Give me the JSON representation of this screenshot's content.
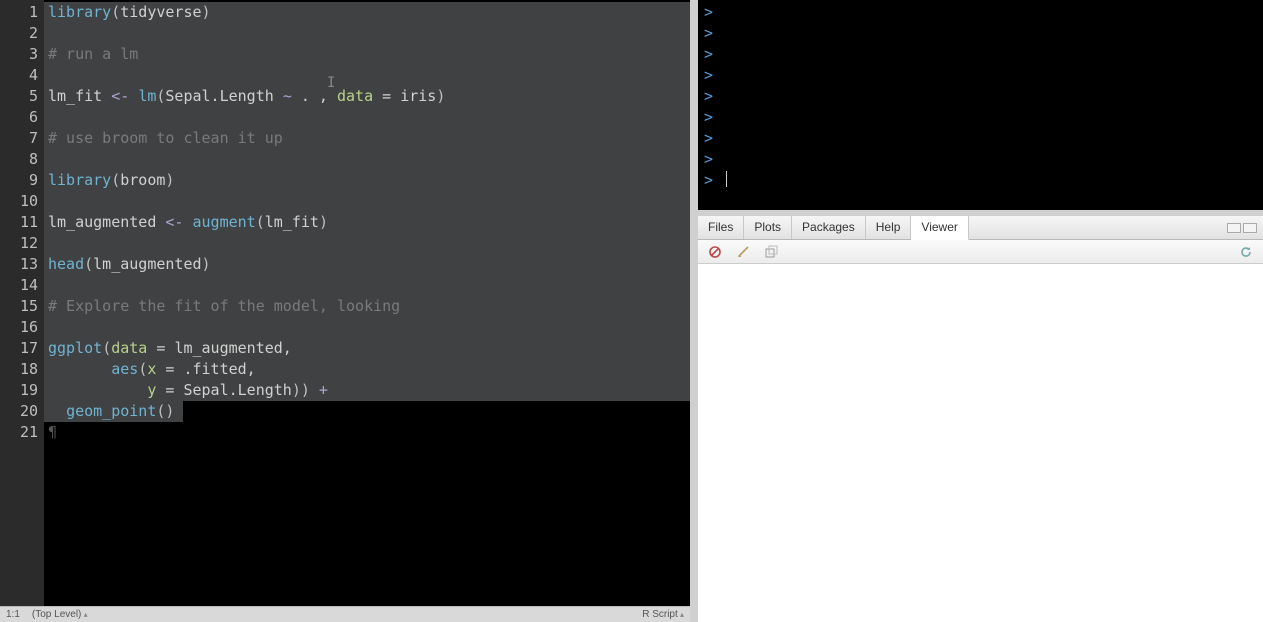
{
  "editor": {
    "lines": [
      {
        "n": 1,
        "tokens": [
          {
            "t": "library",
            "c": "tok-fn"
          },
          {
            "t": "(",
            "c": "tok-punc"
          },
          {
            "t": "tidyverse",
            "c": "tok-id"
          },
          {
            "t": ")",
            "c": "tok-punc"
          }
        ]
      },
      {
        "n": 2,
        "tokens": []
      },
      {
        "n": 3,
        "tokens": [
          {
            "t": "# run a lm",
            "c": "tok-cmt"
          }
        ]
      },
      {
        "n": 4,
        "tokens": []
      },
      {
        "n": 5,
        "tokens": [
          {
            "t": "lm_fit ",
            "c": "tok-id"
          },
          {
            "t": "<-",
            "c": "tok-op"
          },
          {
            "t": " ",
            "c": "tok-id"
          },
          {
            "t": "lm",
            "c": "tok-fn"
          },
          {
            "t": "(",
            "c": "tok-punc"
          },
          {
            "t": "Sepal.Length ",
            "c": "tok-id"
          },
          {
            "t": "~",
            "c": "tok-op"
          },
          {
            "t": " . , ",
            "c": "tok-id"
          },
          {
            "t": "data",
            "c": "tok-name"
          },
          {
            "t": " = ",
            "c": "tok-id"
          },
          {
            "t": "iris",
            "c": "tok-id"
          },
          {
            "t": ")",
            "c": "tok-punc"
          }
        ]
      },
      {
        "n": 6,
        "tokens": []
      },
      {
        "n": 7,
        "tokens": [
          {
            "t": "# use broom to clean it up",
            "c": "tok-cmt"
          }
        ]
      },
      {
        "n": 8,
        "tokens": []
      },
      {
        "n": 9,
        "tokens": [
          {
            "t": "library",
            "c": "tok-fn"
          },
          {
            "t": "(",
            "c": "tok-punc"
          },
          {
            "t": "broom",
            "c": "tok-id"
          },
          {
            "t": ")",
            "c": "tok-punc"
          }
        ]
      },
      {
        "n": 10,
        "tokens": []
      },
      {
        "n": 11,
        "tokens": [
          {
            "t": "lm_augmented ",
            "c": "tok-id"
          },
          {
            "t": "<-",
            "c": "tok-op"
          },
          {
            "t": " ",
            "c": "tok-id"
          },
          {
            "t": "augment",
            "c": "tok-fn"
          },
          {
            "t": "(",
            "c": "tok-punc"
          },
          {
            "t": "lm_fit",
            "c": "tok-id"
          },
          {
            "t": ")",
            "c": "tok-punc"
          }
        ]
      },
      {
        "n": 12,
        "tokens": []
      },
      {
        "n": 13,
        "tokens": [
          {
            "t": "head",
            "c": "tok-fn"
          },
          {
            "t": "(",
            "c": "tok-punc"
          },
          {
            "t": "lm_augmented",
            "c": "tok-id"
          },
          {
            "t": ")",
            "c": "tok-punc"
          }
        ]
      },
      {
        "n": 14,
        "tokens": []
      },
      {
        "n": 15,
        "tokens": [
          {
            "t": "# Explore the fit of the model, looking",
            "c": "tok-cmt"
          }
        ]
      },
      {
        "n": 16,
        "tokens": []
      },
      {
        "n": 17,
        "tokens": [
          {
            "t": "ggplot",
            "c": "tok-fn"
          },
          {
            "t": "(",
            "c": "tok-punc"
          },
          {
            "t": "data",
            "c": "tok-name"
          },
          {
            "t": " = ",
            "c": "tok-id"
          },
          {
            "t": "lm_augmented,",
            "c": "tok-id"
          }
        ]
      },
      {
        "n": 18,
        "tokens": [
          {
            "t": "       ",
            "c": "tok-id"
          },
          {
            "t": "aes",
            "c": "tok-fn"
          },
          {
            "t": "(",
            "c": "tok-punc"
          },
          {
            "t": "x",
            "c": "tok-name"
          },
          {
            "t": " = ",
            "c": "tok-id"
          },
          {
            "t": ".fitted,",
            "c": "tok-id"
          }
        ]
      },
      {
        "n": 19,
        "tokens": [
          {
            "t": "           ",
            "c": "tok-id"
          },
          {
            "t": "y",
            "c": "tok-name"
          },
          {
            "t": " = ",
            "c": "tok-id"
          },
          {
            "t": "Sepal.Length",
            "c": "tok-id"
          },
          {
            "t": "))",
            "c": "tok-punc"
          },
          {
            "t": " +",
            "c": "tok-op"
          }
        ]
      },
      {
        "n": 20,
        "tokens": [
          {
            "t": "  ",
            "c": "tok-id"
          },
          {
            "t": "geom_point",
            "c": "tok-fn"
          },
          {
            "t": "()",
            "c": "tok-punc"
          }
        ]
      },
      {
        "n": 21,
        "tokens": [
          {
            "t": "¶",
            "c": "pilcrow"
          }
        ]
      }
    ],
    "selection_lines": 19,
    "partial_sel_line20_chars": 15
  },
  "statusbar": {
    "pos": "1:1",
    "scope": "(Top Level)",
    "lang": "R Script"
  },
  "console": {
    "prompt": ">",
    "prompt_count": 9
  },
  "tabs": {
    "items": [
      "Files",
      "Plots",
      "Packages",
      "Help",
      "Viewer"
    ],
    "active_index": 4
  }
}
